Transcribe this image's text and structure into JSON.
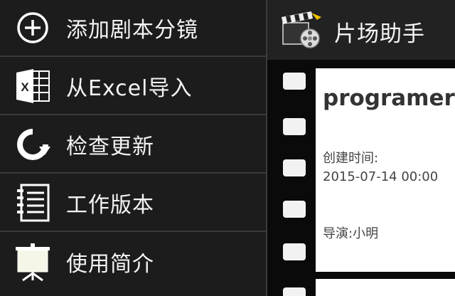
{
  "menu": {
    "items": [
      {
        "label": "添加剧本分镜",
        "icon": "plus-circle-icon"
      },
      {
        "label": "从Excel导入",
        "icon": "excel-icon"
      },
      {
        "label": "检查更新",
        "icon": "refresh-icon"
      },
      {
        "label": "工作版本",
        "icon": "notebook-icon"
      },
      {
        "label": "使用简介",
        "icon": "presentation-board-icon"
      }
    ]
  },
  "header": {
    "title": "片场助手",
    "logo_icon": "clapperboard-film-reel-icon"
  },
  "script_card": {
    "title": "programer",
    "created_label": "创建时间:",
    "created_value": "2015-07-14 00:00",
    "director": "导演:小明"
  },
  "colors": {
    "drawer_bg": "#1c1c1c",
    "action_bar_bg": "#222222",
    "card_bg": "#ffffff",
    "menu_text": "#f4f4f4"
  }
}
